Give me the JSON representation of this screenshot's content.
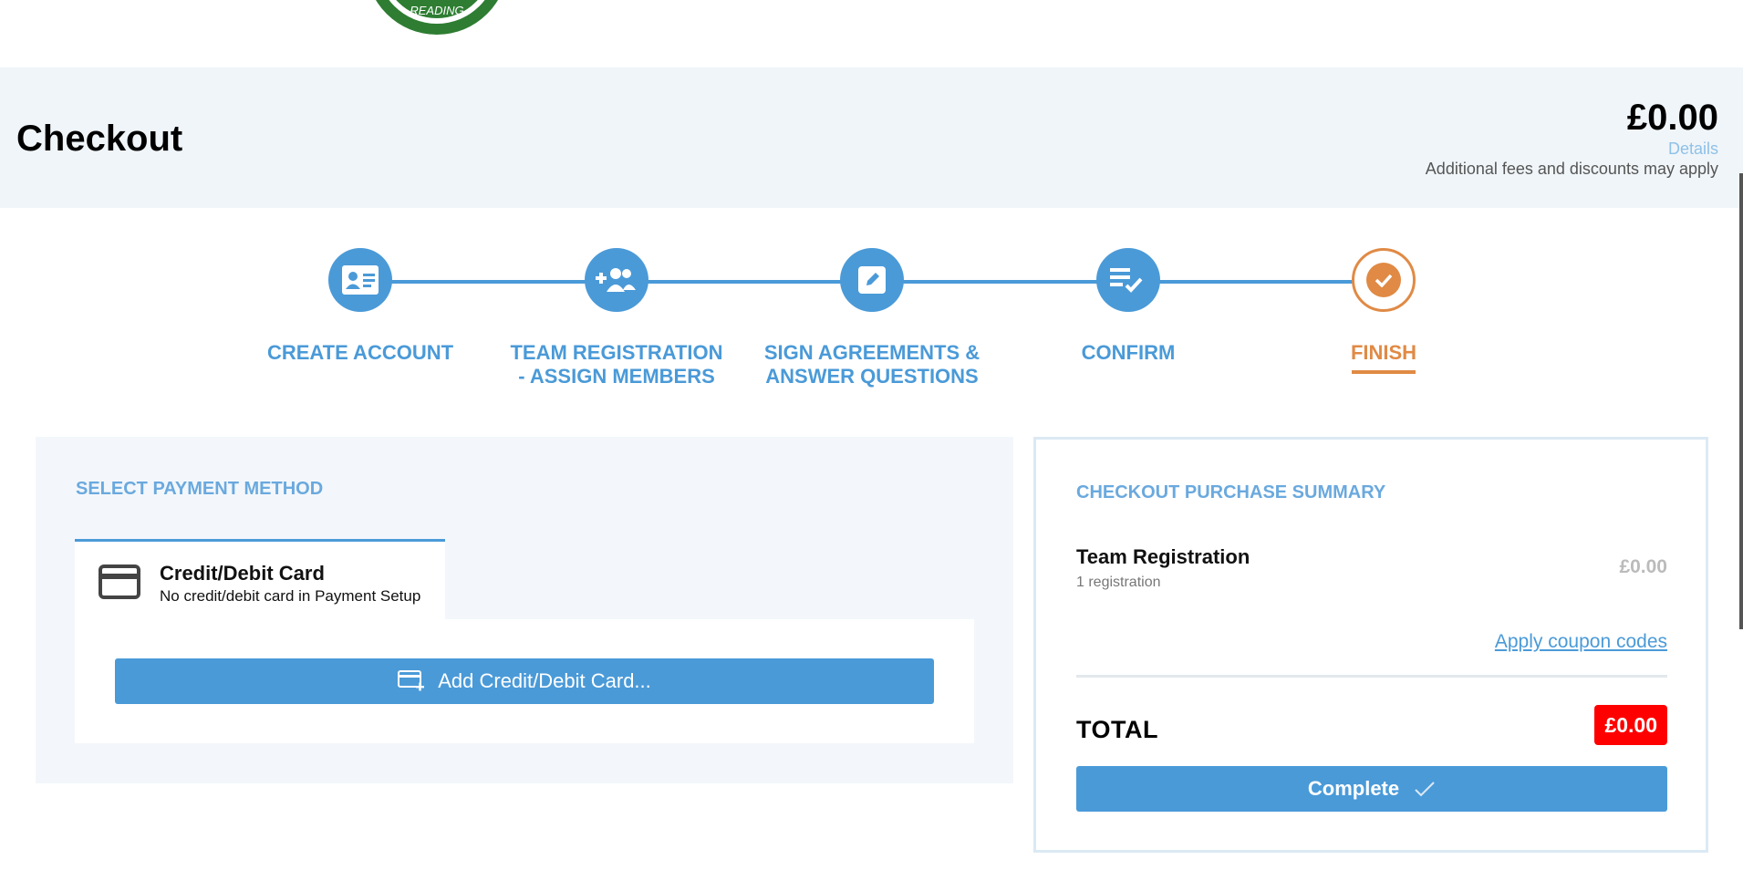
{
  "logo": {
    "text": "READING"
  },
  "header": {
    "title": "Checkout",
    "price": "£0.00",
    "details_link": "Details",
    "fees_note": "Additional fees and discounts may apply"
  },
  "stepper": {
    "steps": [
      {
        "line1": "CREATE ACCOUNT",
        "line2": "",
        "icon": "id-card-icon"
      },
      {
        "line1": "TEAM REGISTRATION",
        "line2": "- ASSIGN MEMBERS",
        "icon": "add-users-icon"
      },
      {
        "line1": "SIGN AGREEMENTS &",
        "line2": "ANSWER QUESTIONS",
        "icon": "edit-icon"
      },
      {
        "line1": "CONFIRM",
        "line2": "",
        "icon": "checklist-icon"
      },
      {
        "line1": "FINISH",
        "line2": "",
        "icon": "check-circle-icon"
      }
    ],
    "active_step": "FINISH"
  },
  "payment": {
    "title": "SELECT PAYMENT METHOD",
    "tab_title": "Credit/Debit Card",
    "tab_subtitle": "No credit/debit card in Payment Setup",
    "add_card_label": "Add Credit/Debit Card..."
  },
  "summary": {
    "title": "CHECKOUT PURCHASE SUMMARY",
    "item_name": "Team Registration",
    "item_sub": "1 registration",
    "item_price": "£0.00",
    "coupon_link": "Apply coupon codes",
    "total_label": "TOTAL",
    "total_price": "£0.00",
    "complete_label": "Complete"
  },
  "colors": {
    "accent": "#4a9ad8",
    "finish": "#e08a45",
    "total_badge": "#ff0000",
    "logo_green": "#2e7d32"
  }
}
